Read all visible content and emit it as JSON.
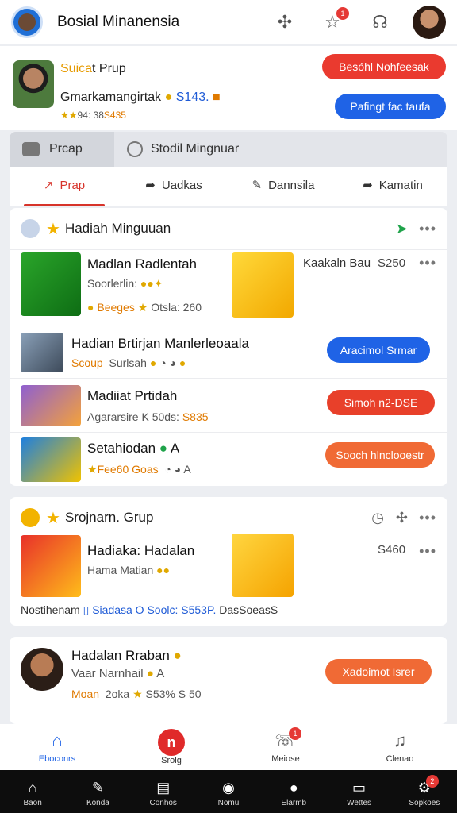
{
  "topbar": {
    "title": "Bosial Minanensia",
    "notif_count": "1",
    "icons": [
      "puzzle-icon",
      "star-icon",
      "headset-icon"
    ]
  },
  "profile": {
    "group_a": "Suica",
    "group_b": "t Prup",
    "name": "Gmarkamangirtak",
    "value": "S143.",
    "stats_a": "94: 38",
    "stats_b": "S435",
    "btn_red": "Besóhl Nohfeesak",
    "btn_blue": "Pafingt fac taufa"
  },
  "tabs_top": [
    "Prcap",
    "Stodil Mingnuar"
  ],
  "tabs_sub": [
    "Prap",
    "Uadkas",
    "Dannsila",
    "Kamatin"
  ],
  "card1": {
    "title": "Hadiah Minguuan",
    "rows": [
      {
        "title": "Madlan Radlentah",
        "sub": "Soorlerlin:",
        "line3a": "Beeges",
        "line3b": "Otsla: 260",
        "right_title": "Kaakaln Bau",
        "amount": "S250"
      },
      {
        "title": "Hadian Brtirjan Manlerleoaala",
        "sub_a": "Scoup",
        "sub_b": "Surlsah",
        "button": "Aracimol Srmar"
      },
      {
        "title": "Madiiat Prtidah",
        "sub_a": "Agararsire K 50ds:",
        "sub_b": "S835",
        "button": "Simoh n2-DSE"
      },
      {
        "title": "Setahiodan",
        "sub_b": "A",
        "stars_text": "Fee60 Goas",
        "button": "Sooch hlnclooestr"
      }
    ]
  },
  "card2": {
    "title": "Srojnarn. Grup",
    "item_title": "Hadiaka: Hadalan",
    "item_sub": "Hama Matian",
    "amount": "S460",
    "footer": "Nostihenam",
    "footer_a": "Siadasa O Soolc: S553P.",
    "footer_b": "DasSoeasS"
  },
  "card3": {
    "title": "Hadalan Rraban",
    "sub": "Vaar Narnhail",
    "sub_b": "A",
    "line3a": "Moan",
    "line3b": "2oka",
    "line3c": "S53% S 50",
    "button": "Xadoimot Isrer"
  },
  "bottom_nav": [
    "Eboconrs",
    "Srolg",
    "Meiose",
    "Clenao"
  ],
  "bottom_badge": "1",
  "system_nav": [
    "Baon",
    "Konda",
    "Conhos",
    "Nomu",
    "Elarmb",
    "Wettes",
    "Sopkoes"
  ],
  "system_badge": "2",
  "colors": {
    "accent_red": "#ea3a2f",
    "accent_blue": "#1f63e6",
    "accent_orange": "#f06a35",
    "gold": "#f2b300"
  }
}
